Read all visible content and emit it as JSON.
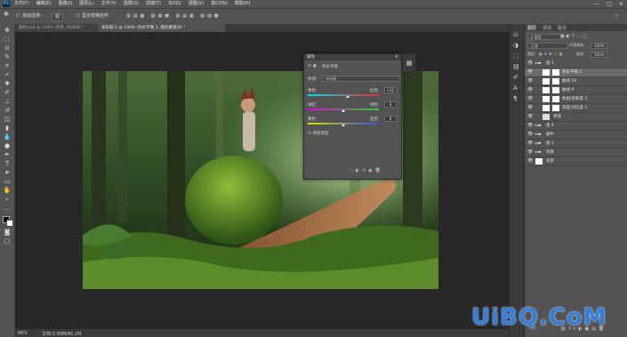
{
  "app": {
    "logo": "Ps"
  },
  "menu": [
    "文件(F)",
    "编辑(E)",
    "图像(I)",
    "图层(L)",
    "文字(Y)",
    "选择(S)",
    "滤镜(T)",
    "3D(D)",
    "视图(V)",
    "窗口(W)",
    "帮助(H)"
  ],
  "window_controls": {
    "minimize": "—",
    "maximize": "□",
    "close": "✕"
  },
  "options": {
    "auto_select_label": "自动选择：",
    "auto_select_value": "组",
    "transform_label": "显示变换控件"
  },
  "tabs": [
    {
      "label": "素材.psd @ 100% (背景, RGB/8) *",
      "active": false
    },
    {
      "label": "未标题-1 @ 100% (色彩平衡 1, 图层蒙版/8) *",
      "active": true
    }
  ],
  "status": {
    "zoom": "66%",
    "doc": "文档:3.00M/45.2M"
  },
  "properties": {
    "title": "属性",
    "subtitle": "色彩平衡",
    "tone_label": "色调:",
    "tone_value": "中间调",
    "sliders": [
      {
        "left": "青色",
        "right": "红色",
        "value": "+12"
      },
      {
        "left": "洋红",
        "right": "绿色",
        "value": "0"
      },
      {
        "left": "黄色",
        "right": "蓝色",
        "value": "0"
      }
    ],
    "preserve_label": "保留明度"
  },
  "layers_panel": {
    "tabs": [
      "图层",
      "通道",
      "路径"
    ],
    "kind_label": "ρ 类型",
    "blend_mode": "正常",
    "opacity_label": "不透明度:",
    "opacity_value": "100%",
    "fill_label": "填充:",
    "fill_value": "100%",
    "lock_label": "锁定:",
    "rows": [
      {
        "name": "组 1",
        "type": "group"
      },
      {
        "name": "色彩平衡 1",
        "type": "adj"
      },
      {
        "name": "曲线 10",
        "type": "adj"
      },
      {
        "name": "曲线 9",
        "type": "adj"
      },
      {
        "name": "色相/饱和度 1",
        "type": "adj"
      },
      {
        "name": "亮度/对比度 1",
        "type": "adj"
      },
      {
        "name": "男孩",
        "type": "img"
      },
      {
        "name": "组 4",
        "type": "group"
      },
      {
        "name": "蜗牛",
        "type": "group"
      },
      {
        "name": "组 3",
        "type": "group"
      },
      {
        "name": "背景",
        "type": "group"
      },
      {
        "name": "背景",
        "type": "bg"
      }
    ]
  },
  "watermark": "UiBQ.CoM",
  "colors": {
    "accent": "#31a8ff",
    "panel": "#535353",
    "canvas": "#282828"
  }
}
